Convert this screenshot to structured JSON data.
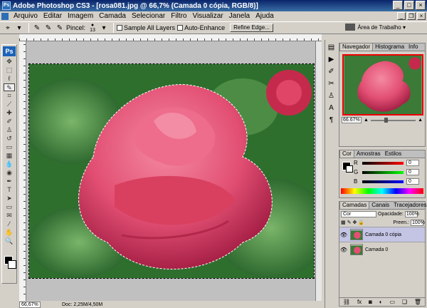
{
  "window": {
    "app_icon": "Ps",
    "title": "Adobe Photoshop CS3 - [rosa081.jpg @ 66,7% (Camada 0 cópia, RGB/8)]"
  },
  "menubar": {
    "items": [
      "Arquivo",
      "Editar",
      "Imagem",
      "Camada",
      "Selecionar",
      "Filtro",
      "Visualizar",
      "Janela",
      "Ajuda"
    ]
  },
  "options": {
    "brush_label": "Pincel:",
    "brush_size": "13",
    "sample_all_layers": "Sample All Layers",
    "auto_enhance": "Auto-Enhance",
    "refine_edge": "Refine Edge...",
    "workspace": "Área de Trabalho ▾"
  },
  "toolbox": {
    "logo": "Ps"
  },
  "document": {
    "zoom": "66,67%",
    "doc_info": "Doc: 2,25M/4,50M"
  },
  "navigator": {
    "tabs": [
      "Navegador",
      "Histograma",
      "Info"
    ],
    "zoom": "66.67%"
  },
  "color_panel": {
    "tabs": [
      "Cor",
      "Amostras",
      "Estilos"
    ],
    "channels": [
      {
        "label": "R",
        "value": "0",
        "gradient": "linear-gradient(90deg,#000,#f00)"
      },
      {
        "label": "G",
        "value": "0",
        "gradient": "linear-gradient(90deg,#000,#0f0)"
      },
      {
        "label": "B",
        "value": "0",
        "gradient": "linear-gradient(90deg,#000,#00f)"
      }
    ]
  },
  "layers_panel": {
    "tabs": [
      "Camadas",
      "Canais",
      "Tracejadores"
    ],
    "blend_mode": "Cor",
    "opacity_label": "Opacidade:",
    "opacity": "100%",
    "fill_label": "Preen.:",
    "fill": "100%",
    "layers": [
      {
        "name": "Camada 0 cópia",
        "active": true
      },
      {
        "name": "Camada 0",
        "active": false
      }
    ]
  }
}
